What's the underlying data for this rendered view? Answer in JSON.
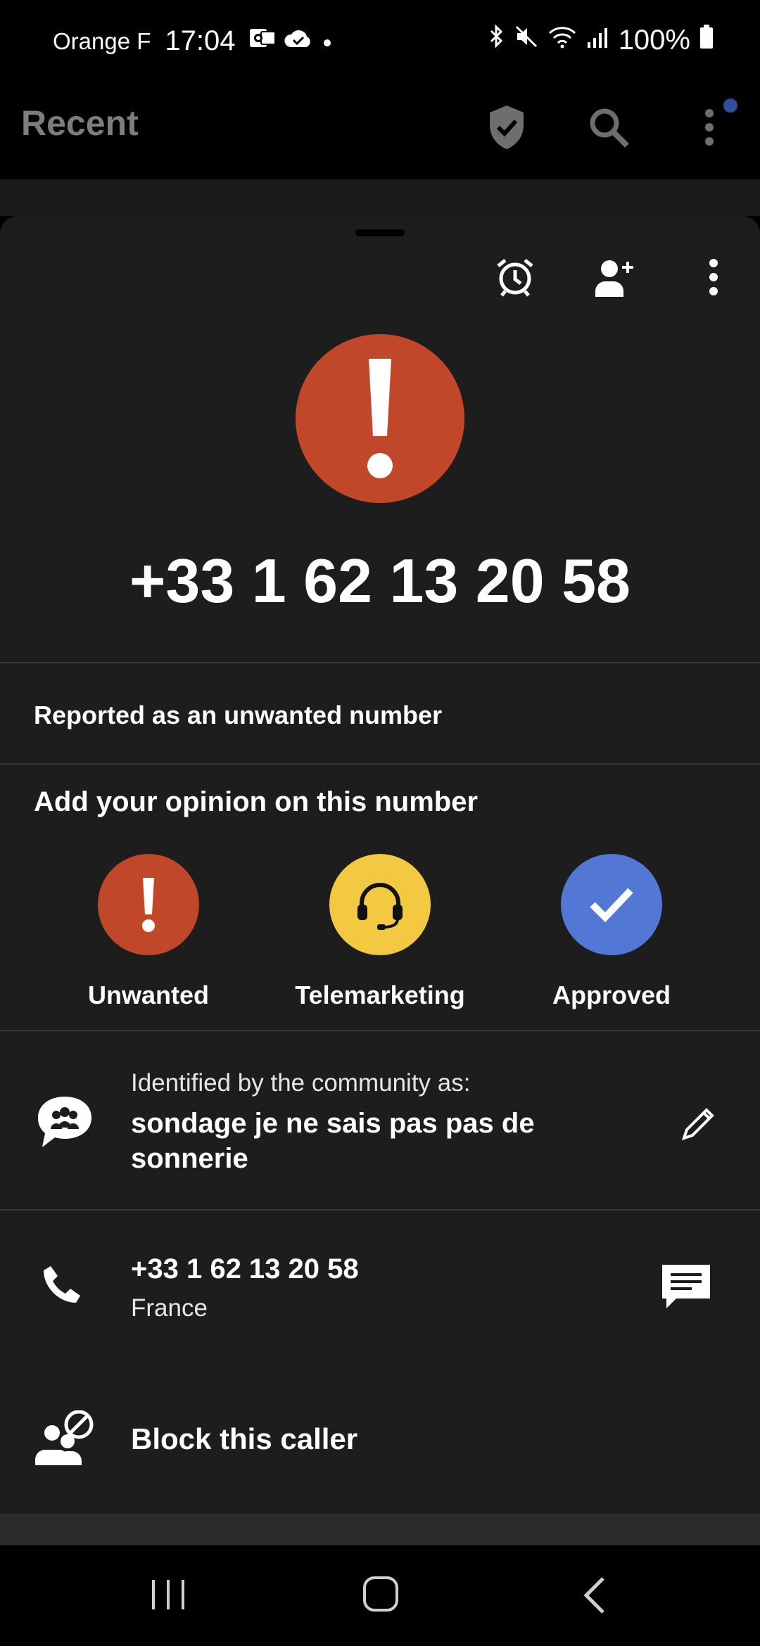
{
  "status_bar": {
    "carrier": "Orange F",
    "time": "17:04",
    "battery": "100%"
  },
  "header": {
    "title": "Recent",
    "icons": [
      "shield-check-icon",
      "search-icon",
      "more-vert-icon"
    ]
  },
  "caller": {
    "number": "+33 1 62 13 20 58",
    "status_text": "Reported as an unwanted number",
    "alert_color": "#c0472a"
  },
  "opinion": {
    "title": "Add your opinion on this number",
    "options": [
      {
        "label": "Unwanted",
        "color": "#c0472a",
        "icon": "exclamation-icon"
      },
      {
        "label": "Telemarketing",
        "color": "#f3c941",
        "icon": "headset-icon"
      },
      {
        "label": "Approved",
        "color": "#5377d4",
        "icon": "check-icon"
      }
    ]
  },
  "community": {
    "label": "Identified by the community as:",
    "value": "sondage je ne sais pas pas de sonnerie"
  },
  "number_row": {
    "number": "+33 1 62 13 20 58",
    "country": "France"
  },
  "block": {
    "label": "Block this caller"
  }
}
